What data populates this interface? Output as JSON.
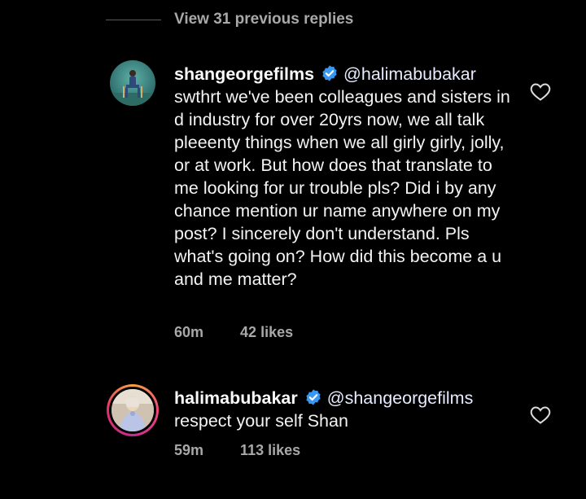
{
  "thread": {
    "view_replies_label": "View 31 previous replies"
  },
  "comments": [
    {
      "username": "shangeorgefilms",
      "mention": "@halimabubakar",
      "text": "swthrt we've been colleagues and sisters in d industry for over 20yrs now, we all talk pleeenty things when we all girly girly, jolly, or at work. But how does that translate to me looking for ur trouble pls? Did i by any chance mention ur name anywhere on my post? I sincerely don't understand. Pls what's going on? How did this become a u and me matter?",
      "time": "60m",
      "likes": "42 likes",
      "verified": true,
      "icon": "heart-outline-icon"
    },
    {
      "username": "halimabubakar",
      "mention": "@shangeorgefilms",
      "text": "respect your self Shan",
      "time": "59m",
      "likes": "113 likes",
      "verified": true,
      "icon": "heart-outline-icon"
    }
  ],
  "colors": {
    "background": "#000000",
    "verified_badge": "#3897f0",
    "muted_text": "#a8a8a8"
  }
}
